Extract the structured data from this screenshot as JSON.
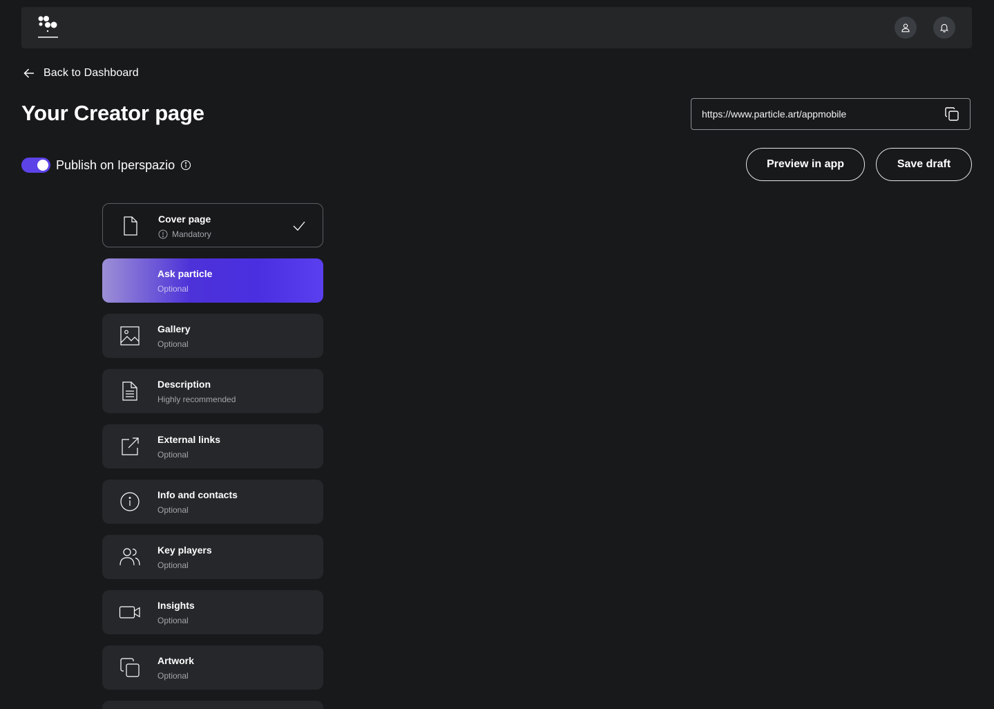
{
  "header": {
    "logo_icon": "particle-logo-icon",
    "profile_icon": "user-icon",
    "notifications_icon": "bell-icon"
  },
  "nav": {
    "back_label": "Back to Dashboard"
  },
  "page": {
    "title": "Your Creator page"
  },
  "url": {
    "value": "https://www.particle.art/appmobile"
  },
  "publish": {
    "label": "Publish on Iperspazio",
    "enabled": true,
    "accent": "#5b43e8"
  },
  "actions": {
    "preview_label": "Preview in app",
    "save_label": "Save draft"
  },
  "sections": [
    {
      "title": "Cover page",
      "subtitle": "Mandatory",
      "icon": "document-icon",
      "state": "completed"
    },
    {
      "title": "Ask particle",
      "subtitle": "Optional",
      "icon": "none",
      "state": "active"
    },
    {
      "title": "Gallery",
      "subtitle": "Optional",
      "icon": "image-icon",
      "state": "default"
    },
    {
      "title": "Description",
      "subtitle": "Highly recommended",
      "icon": "text-document-icon",
      "state": "default"
    },
    {
      "title": "External links",
      "subtitle": "Optional",
      "icon": "external-link-icon",
      "state": "default"
    },
    {
      "title": "Info and contacts",
      "subtitle": "Optional",
      "icon": "info-icon",
      "state": "default"
    },
    {
      "title": "Key players",
      "subtitle": "Optional",
      "icon": "people-icon",
      "state": "default"
    },
    {
      "title": "Insights",
      "subtitle": "Optional",
      "icon": "video-icon",
      "state": "default"
    },
    {
      "title": "Artwork",
      "subtitle": "Optional",
      "icon": "copy-icon",
      "state": "default"
    }
  ]
}
